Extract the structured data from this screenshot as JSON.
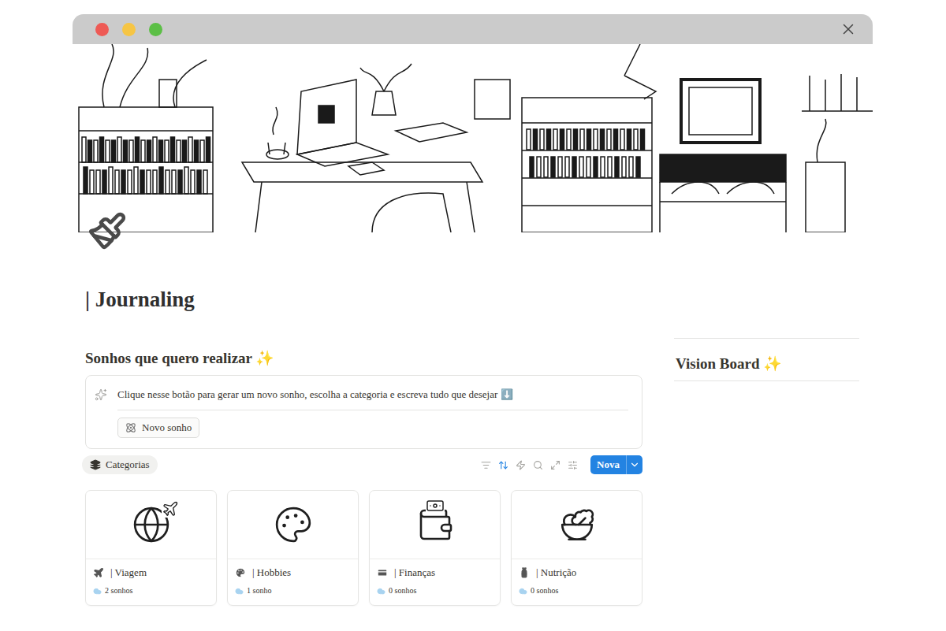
{
  "page": {
    "title": "| Journaling"
  },
  "dreams": {
    "heading": "Sonhos que quero realizar ✨",
    "callout": {
      "text": "Clique nesse botão para gerar um novo sonho, escolha a categoria e escreva tudo que desejar ⬇️",
      "button": "Novo sonho"
    },
    "view_tab": {
      "label": "Categorias",
      "selected": true
    },
    "toolbar": [
      {
        "kind": "filter",
        "active": false
      },
      {
        "kind": "sort",
        "active": true
      },
      {
        "kind": "automation",
        "active": false
      },
      {
        "kind": "search",
        "active": false
      },
      {
        "kind": "expand",
        "active": false
      },
      {
        "kind": "settings",
        "active": false
      }
    ],
    "new_button": "Nova",
    "cards": [
      {
        "title": "| Viagem",
        "count": "2 sonhos"
      },
      {
        "title": "| Hobbies",
        "count": "1 sonho"
      },
      {
        "title": "| Finanças",
        "count": "0 sonhos"
      },
      {
        "title": "| Nutrição",
        "count": "0 sonhos"
      }
    ]
  },
  "vision_board": {
    "heading": "Vision Board ✨"
  }
}
